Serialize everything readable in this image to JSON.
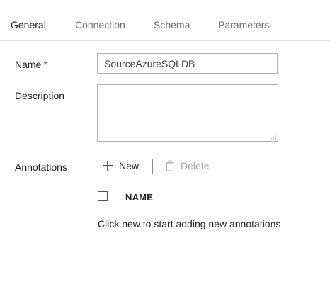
{
  "tabs": [
    {
      "label": "General",
      "active": true
    },
    {
      "label": "Connection",
      "active": false
    },
    {
      "label": "Schema",
      "active": false
    },
    {
      "label": "Parameters",
      "active": false
    }
  ],
  "form": {
    "name_label": "Name",
    "required_marker": "*",
    "name_value": "SourceAzureSQLDB",
    "description_label": "Description",
    "description_value": "",
    "annotations_label": "Annotations"
  },
  "annotations": {
    "new_label": "New",
    "delete_label": "Delete",
    "column_name": "NAME",
    "empty_hint": "Click new to start adding new annotations"
  },
  "colors": {
    "required": "#c23934",
    "disabled_text": "#a6a6a6",
    "border": "#b0b0b0"
  },
  "icons": {
    "new": "plus-icon",
    "delete": "trash-icon",
    "resize": "resize-grip-icon"
  }
}
